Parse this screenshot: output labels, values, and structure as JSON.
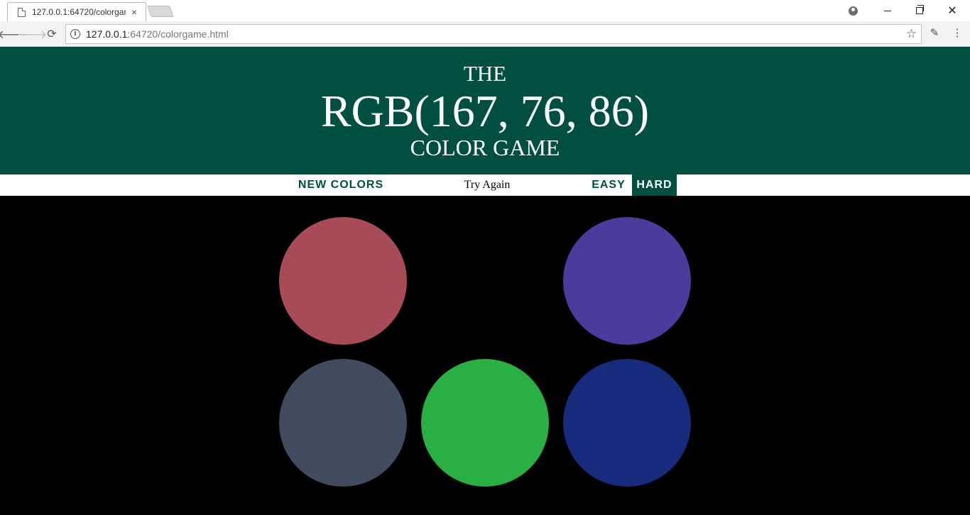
{
  "browser": {
    "tab_title": "127.0.0.1:64720/colorgame.html",
    "tab_close": "×",
    "url_host": "127.0.0.1",
    "url_rest": ":64720/colorgame.html",
    "info_glyph": "i",
    "back_glyph": "🡐",
    "forward_glyph": "🡒",
    "reload_glyph": "⟳",
    "star_glyph": "☆",
    "eyedropper_glyph": "✎",
    "menu_glyph": "⋮",
    "close_glyph": "✕"
  },
  "header": {
    "line1": "THE",
    "color_display": "RGB(167, 76, 86)",
    "line3": "COLOR GAME",
    "background": "#004f41"
  },
  "controls": {
    "new_colors": "NEW COLORS",
    "message": "Try Again",
    "easy": "EASY",
    "hard": "HARD",
    "selected_mode": "HARD"
  },
  "squares": [
    {
      "color": "#a74c56",
      "visible": true
    },
    {
      "color": "#000000",
      "visible": false
    },
    {
      "color": "#4b3c9c",
      "visible": true
    },
    {
      "color": "#414b60",
      "visible": true
    },
    {
      "color": "#2aaf44",
      "visible": true
    },
    {
      "color": "#172a7c",
      "visible": true
    }
  ]
}
